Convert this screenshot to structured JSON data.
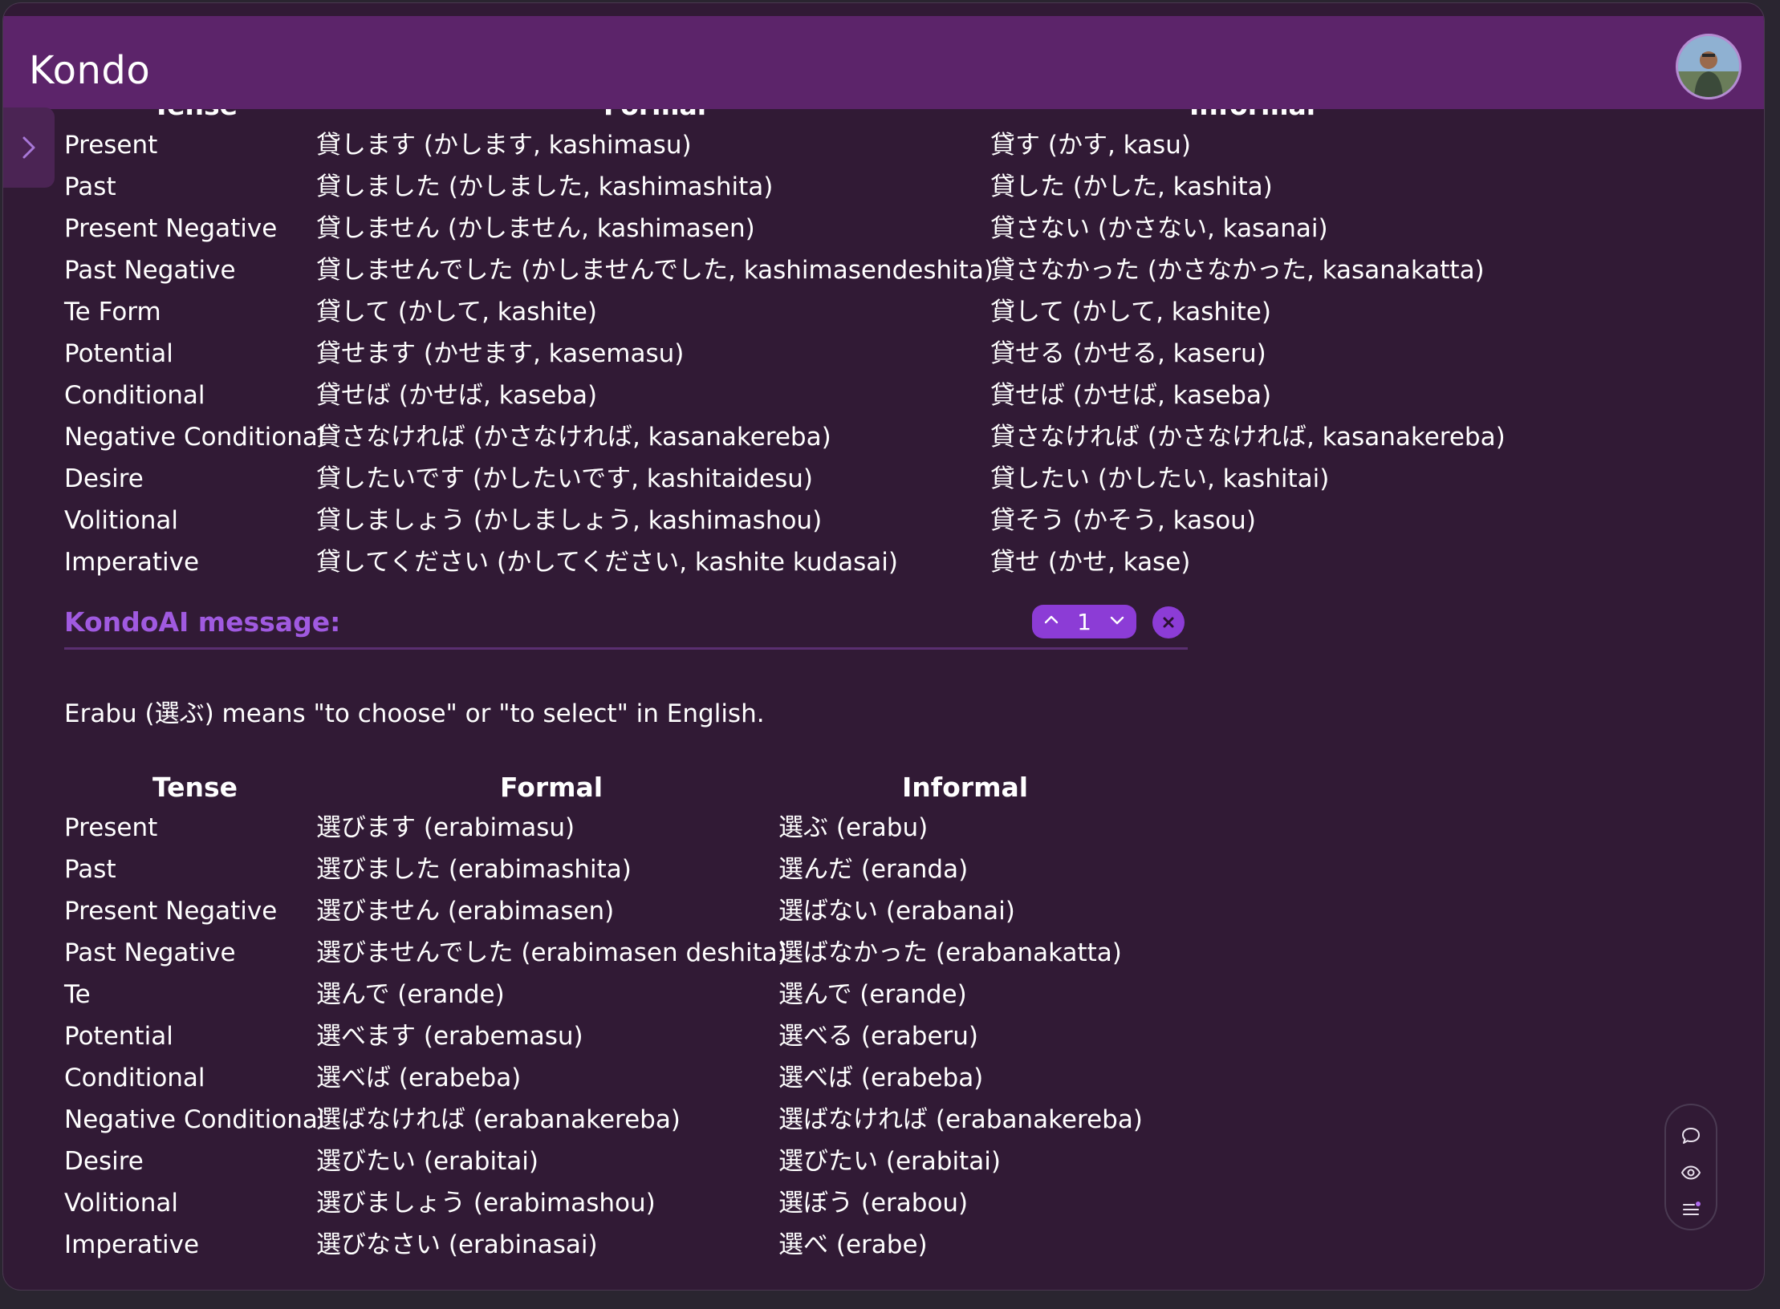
{
  "app": {
    "title": "Kondo"
  },
  "table1": {
    "headers": {
      "tense": "Tense",
      "formal": "Formal",
      "informal": "Informal"
    },
    "rows": [
      {
        "tense": "Present",
        "formal": "貸します (かします, kashimasu)",
        "informal": "貸す (かす, kasu)"
      },
      {
        "tense": "Past",
        "formal": "貸しました (かしました, kashimashita)",
        "informal": "貸した (かした, kashita)"
      },
      {
        "tense": "Present Negative",
        "formal": "貸しません (かしません, kashimasen)",
        "informal": "貸さない (かさない, kasanai)"
      },
      {
        "tense": "Past Negative",
        "formal": "貸しませんでした (かしませんでした, kashimasendeshita)",
        "informal": "貸さなかった (かさなかった, kasanakatta)"
      },
      {
        "tense": "Te Form",
        "formal": "貸して (かして, kashite)",
        "informal": "貸して (かして, kashite)"
      },
      {
        "tense": "Potential",
        "formal": "貸せます (かせます, kasemasu)",
        "informal": "貸せる (かせる, kaseru)"
      },
      {
        "tense": "Conditional",
        "formal": "貸せば (かせば, kaseba)",
        "informal": "貸せば (かせば, kaseba)"
      },
      {
        "tense": "Negative Conditional",
        "formal": "貸さなければ (かさなければ, kasanakereba)",
        "informal": "貸さなければ (かさなければ, kasanakereba)"
      },
      {
        "tense": "Desire",
        "formal": "貸したいです (かしたいです, kashitaidesu)",
        "informal": "貸したい (かしたい, kashitai)"
      },
      {
        "tense": "Volitional",
        "formal": "貸しましょう (かしましょう, kashimashou)",
        "informal": "貸そう (かそう, kasou)"
      },
      {
        "tense": "Imperative",
        "formal": "貸してください (かしてください, kashite kudasai)",
        "informal": "貸せ (かせ, kase)"
      }
    ]
  },
  "kondoai": {
    "label": "KondoAI message:",
    "counter": "1",
    "intro": "Erabu (選ぶ) means \"to choose\" or \"to select\" in English."
  },
  "table2": {
    "headers": {
      "tense": "Tense",
      "formal": "Formal",
      "informal": "Informal"
    },
    "rows": [
      {
        "tense": "Present",
        "formal": "選びます (erabimasu)",
        "informal": "選ぶ (erabu)"
      },
      {
        "tense": "Past",
        "formal": "選びました (erabimashita)",
        "informal": "選んだ (eranda)"
      },
      {
        "tense": "Present Negative",
        "formal": "選びません (erabimasen)",
        "informal": "選ばない (erabanai)"
      },
      {
        "tense": "Past Negative",
        "formal": "選びませんでした (erabimasen deshita)",
        "informal": "選ばなかった (erabanakatta)"
      },
      {
        "tense": "Te",
        "formal": "選んで (erande)",
        "informal": "選んで (erande)"
      },
      {
        "tense": "Potential",
        "formal": "選べます (erabemasu)",
        "informal": "選べる (eraberu)"
      },
      {
        "tense": "Conditional",
        "formal": "選べば (erabeba)",
        "informal": "選べば (erabeba)"
      },
      {
        "tense": "Negative Conditional",
        "formal": "選ばなければ (erabanakereba)",
        "informal": "選ばなければ (erabanakereba)"
      },
      {
        "tense": "Desire",
        "formal": "選びたい (erabitai)",
        "informal": "選びたい (erabitai)"
      },
      {
        "tense": "Volitional",
        "formal": "選びましょう (erabimashou)",
        "informal": "選ぼう (erabou)"
      },
      {
        "tense": "Imperative",
        "formal": "選びなさい (erabinasai)",
        "informal": "選べ (erabe)"
      }
    ]
  },
  "icons": {
    "sidebar_toggle": "chevron-right-icon",
    "nav_up": "chevron-up-icon",
    "nav_down": "chevron-down-icon",
    "close": "close-icon",
    "chat": "chat-bubble-icon",
    "eye": "eye-icon",
    "menu": "menu-icon"
  },
  "colors": {
    "header": "#5c246a",
    "background": "#311a35",
    "accent": "#8c3cd6",
    "label": "#a05ae0"
  }
}
